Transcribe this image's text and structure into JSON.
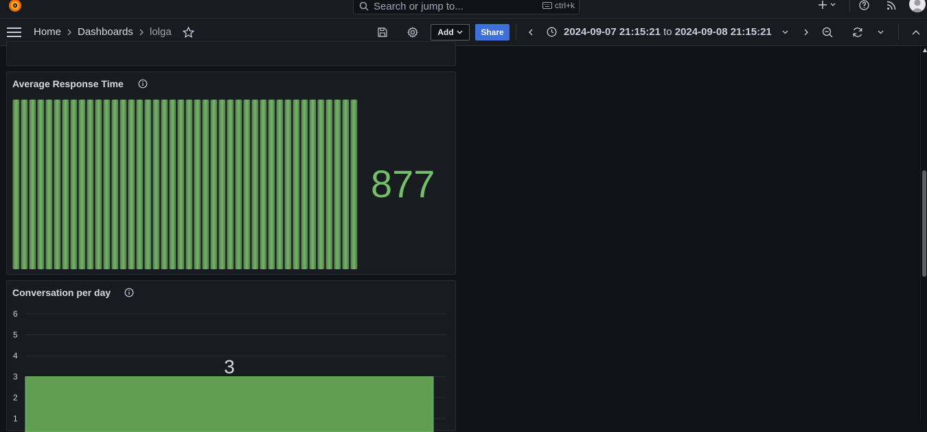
{
  "topbar": {
    "search_placeholder": "Search or jump to...",
    "search_shortcut": "ctrl+k"
  },
  "navbar": {
    "breadcrumb": [
      "Home",
      "Dashboards",
      "lolga"
    ],
    "add_label": "Add",
    "share_label": "Share",
    "time_from": "2024-09-07 21:15:21",
    "time_to_word": "to",
    "time_to": "2024-09-08 21:15:21"
  },
  "panels": {
    "avg_response": {
      "title": "Average Response Time",
      "value": "877",
      "bar_count": 42,
      "color": "#73bf69"
    },
    "conversation": {
      "title": "Conversation per day",
      "bar_label": "3",
      "bar_color": "#629e51"
    }
  },
  "chart_data": {
    "type": "bar",
    "categories": [
      ""
    ],
    "values": [
      3
    ],
    "title": "Conversation per day",
    "xlabel": "",
    "ylabel": "",
    "ylim": [
      0,
      6
    ],
    "yticks": [
      "1",
      "2",
      "3",
      "4",
      "5",
      "6"
    ],
    "grid": true
  },
  "colors": {
    "accent": "#3d71d9",
    "background": "#111217",
    "panel": "#181b1f",
    "green": "#73bf69"
  }
}
